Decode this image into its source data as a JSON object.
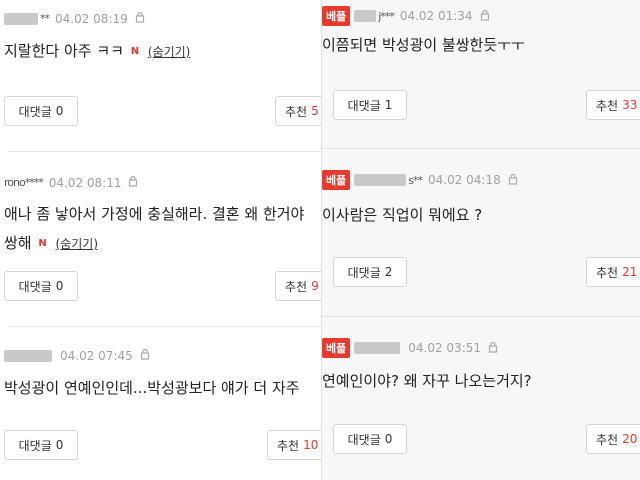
{
  "left": [
    {
      "username": "**",
      "date": "04.02 08:19",
      "text": "지랄한다 아주 ㅋㅋ",
      "n_badge": "N",
      "hide_label": "(숨기기)",
      "reply_label": "대댓글",
      "reply_count": "0",
      "recommend_label": "추천",
      "recommend_count": "5"
    },
    {
      "username": "rono****",
      "date": "04.02 08:11",
      "text": "애나 좀 낳아서 가정에 충실해라. 결혼 왜 한거야",
      "text2": "쌍해",
      "n_badge": "N",
      "hide_label": "(숨기기)",
      "reply_label": "대댓글",
      "reply_count": "0",
      "recommend_label": "추천",
      "recommend_count": "9"
    },
    {
      "username": "",
      "date": "04.02 07:45",
      "text": "박성광이 연예인인데...박성광보다 얘가 더 자주",
      "reply_label": "대댓글",
      "reply_count": "0",
      "recommend_label": "추천",
      "recommend_count": "10"
    }
  ],
  "right": [
    {
      "badge": "베플",
      "username": "j***",
      "date": "04.02 01:34",
      "text": "이쯤되면 박성광이 불쌍한듯ㅜㅜ",
      "reply_label": "대댓글",
      "reply_count": "1",
      "recommend_label": "추천",
      "recommend_count": "33"
    },
    {
      "badge": "베플",
      "username": "s**",
      "date": "04.02 04:18",
      "text": "이사람은 직업이 뭐에요 ?",
      "reply_label": "대댓글",
      "reply_count": "2",
      "recommend_label": "추천",
      "recommend_count": "21"
    },
    {
      "badge": "베플",
      "username": "",
      "date": "04.02 03:51",
      "text": "연예인이야? 왜 자꾸 나오는거지?",
      "reply_label": "대댓글",
      "reply_count": "0",
      "recommend_label": "추천",
      "recommend_count": "20"
    }
  ],
  "colors": {
    "accent": "#e8392f",
    "meta": "#999999",
    "border": "#d6d6d6"
  },
  "icons": {
    "lock": "lock-icon"
  }
}
